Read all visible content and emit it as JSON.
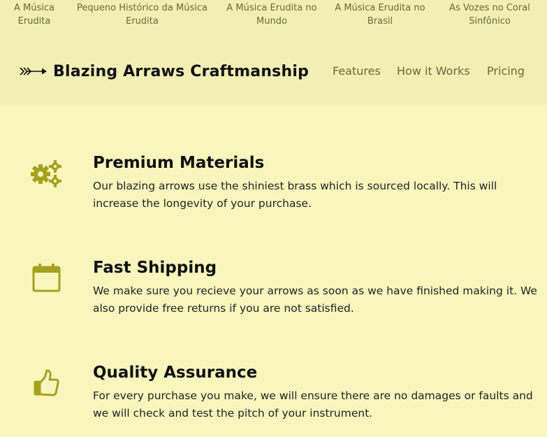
{
  "top_links": [
    {
      "line1": "A Música",
      "line2": "Erudita"
    },
    {
      "line1": "Pequeno Histórico da Música",
      "line2": "Erudita"
    },
    {
      "line1": "A Música Erudita no",
      "line2": "Mundo"
    },
    {
      "line1": "A Música Erudita no",
      "line2": "Brasil"
    },
    {
      "line1": "As Vozes no Coral",
      "line2": "Sinfônico"
    }
  ],
  "brand": {
    "title": "Blazing Arraws Craftmanship",
    "icon": "arrow-icon"
  },
  "main_nav": [
    {
      "label": "Features"
    },
    {
      "label": "How it Works"
    },
    {
      "label": "Pricing"
    }
  ],
  "features": [
    {
      "icon": "gears-icon",
      "title": "Premium Materials",
      "text": "Our blazing arrows use the shiniest brass which is sourced locally. This will increase the longevity of your purchase."
    },
    {
      "icon": "calendar-icon",
      "title": "Fast Shipping",
      "text": "We make sure you recieve your arrows as soon as we have finished making it. We also provide free returns if you are not satisfied."
    },
    {
      "icon": "thumbs-up-icon",
      "title": "Quality Assurance",
      "text": "For every purchase you make, we will ensure there are no damages or faults and we will check and test the pitch of your instrument."
    }
  ],
  "colors": {
    "page_bg": "#f8f6bd",
    "header_bg": "#f1efb4",
    "icon_accent": "#a6a01d",
    "nav_text": "#6b6a3a"
  }
}
